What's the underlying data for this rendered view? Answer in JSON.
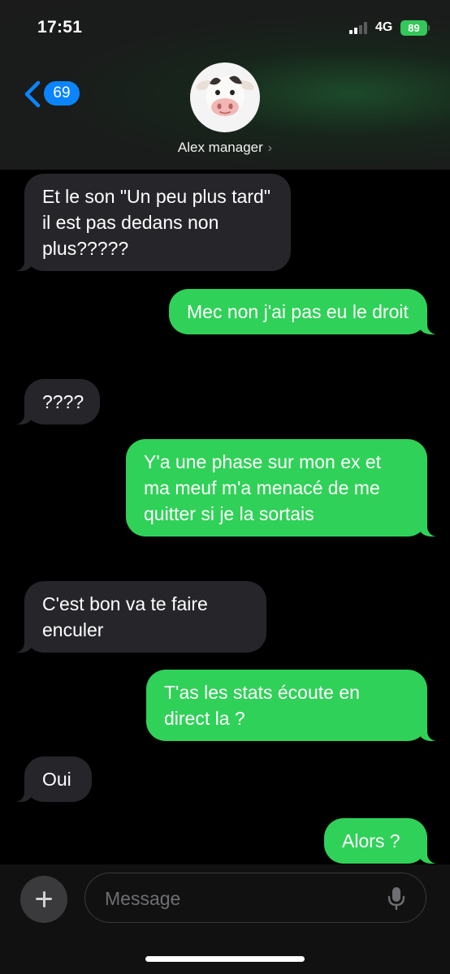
{
  "status_bar": {
    "time": "17:51",
    "network": "4G",
    "battery": "89"
  },
  "header": {
    "back_count": "69",
    "contact_name": "Alex manager",
    "chevron": "›",
    "avatar_icon": "cow-memoji-icon"
  },
  "messages": [
    {
      "direction": "received",
      "text": "Et le son \"Un peu plus tard\" il est pas dedans non plus?????"
    },
    {
      "direction": "sent",
      "text": "Mec non j'ai pas eu le droit"
    },
    {
      "direction": "received",
      "text": "????"
    },
    {
      "direction": "sent",
      "text": "Y'a une phase sur mon ex et ma meuf m'a menacé de me quitter si je la sortais"
    },
    {
      "direction": "received",
      "text": "C'est bon va te faire enculer"
    },
    {
      "direction": "sent",
      "text": "T'as les stats écoute en direct la ?"
    },
    {
      "direction": "received",
      "text": "Oui"
    },
    {
      "direction": "sent",
      "text": "Alors ?"
    }
  ],
  "compose": {
    "placeholder": "Message"
  },
  "colors": {
    "sent": "#30d158",
    "received": "#26252a",
    "accent": "#0a84ff",
    "battery": "#34c759"
  }
}
